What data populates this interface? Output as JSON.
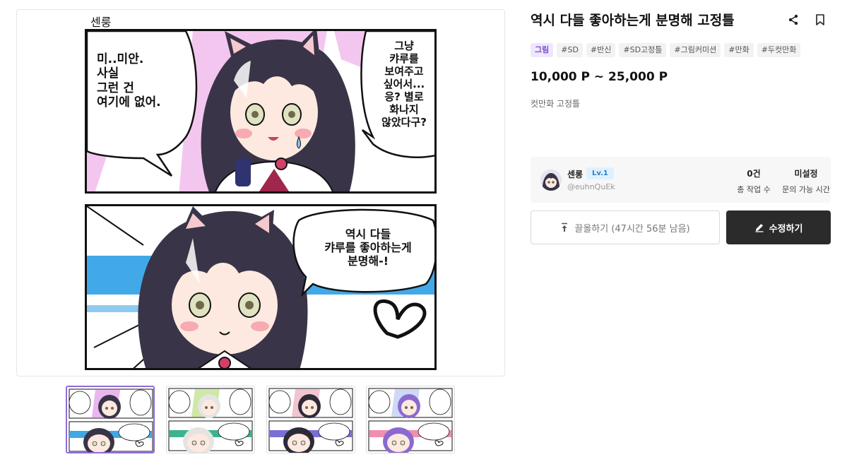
{
  "artwork": {
    "signature": "센룽",
    "panel1": {
      "left_bubble": "미..미안.\n사실\n그런 건\n여기에 없어.",
      "right_bubble": "그냥\n캬루를\n보여주고\n싶어서...\n응? 별로\n화나지\n않았다구?"
    },
    "panel2": {
      "bubble": "역시 다들\n캬루를 좋아하는게\n분명해-!"
    }
  },
  "thumbnails": [
    {
      "label": "thumbnail-1",
      "hair": "#3a3448",
      "accent": "#e9b6ee",
      "stripe": "#3fa8e6"
    },
    {
      "label": "thumbnail-2",
      "hair": "#e4e4e0",
      "accent": "#cfe8a8",
      "stripe": "#3bb38f"
    },
    {
      "label": "thumbnail-3",
      "hair": "#2e2a38",
      "accent": "#f1c4d0",
      "stripe": "#7a6fd6"
    },
    {
      "label": "thumbnail-4",
      "hair": "#8a6ad0",
      "accent": "#cfd8f6",
      "stripe": "#f08fb0"
    }
  ],
  "product": {
    "title": "역시 다들 좋아하는게 분명해 고정틀",
    "tags": [
      "그림",
      "#SD",
      "#반신",
      "#SD고정틀",
      "#그림커미션",
      "#만화",
      "#두컷만화"
    ],
    "price": "10,000 P ~ 25,000 P",
    "description": "컷만화 고정틀"
  },
  "seller": {
    "name": "센롱",
    "level": "Lv.1",
    "handle": "@euhnQuEk",
    "works_value": "0건",
    "works_label": "총 작업 수",
    "hours_value": "미설정",
    "hours_label": "문의 가능 시간"
  },
  "actions": {
    "pull_label": "끌올하기 (47시간 56분 남음)",
    "edit_label": "수정하기"
  },
  "colors": {
    "accent_purple": "#7a4fc9",
    "dark_button": "#2b2b2b",
    "hair": "#3a3448",
    "pink_bg": "#f3c6f0",
    "blue_bg": "#41a9e8"
  }
}
